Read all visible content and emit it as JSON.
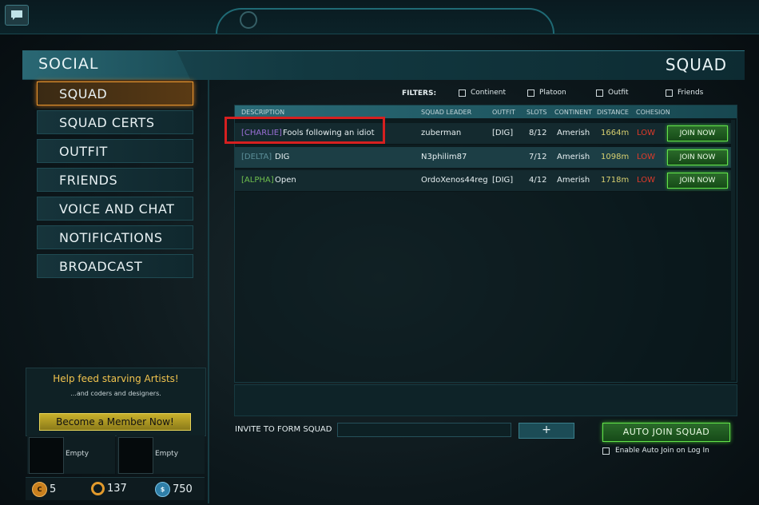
{
  "header": {
    "left_title": "SOCIAL",
    "right_title": "SQUAD"
  },
  "sidebar": {
    "items": [
      {
        "label": "SQUAD",
        "active": true
      },
      {
        "label": "SQUAD CERTS"
      },
      {
        "label": "OUTFIT"
      },
      {
        "label": "FRIENDS"
      },
      {
        "label": "VOICE AND CHAT"
      },
      {
        "label": "NOTIFICATIONS"
      },
      {
        "label": "BROADCAST"
      }
    ]
  },
  "promo": {
    "title": "Help feed starving Artists!",
    "subtitle": "...and coders and designers.",
    "button": "Become a Member Now!"
  },
  "slots": [
    {
      "label": "Empty"
    },
    {
      "label": "Empty"
    }
  ],
  "currency": {
    "certs": "5",
    "coin": "137",
    "cash": "750"
  },
  "filters": {
    "label": "FILTERS:",
    "options": [
      "Continent",
      "Platoon",
      "Outfit",
      "Friends"
    ]
  },
  "table": {
    "columns": [
      "DESCRIPTION",
      "SQUAD LEADER",
      "OUTFIT",
      "SLOTS",
      "CONTINENT",
      "DISTANCE",
      "COHESION"
    ],
    "rows": [
      {
        "tag": "[CHARLIE]",
        "name": "Fools following an idiot",
        "leader": "zuberman",
        "outfit": "[DIG]",
        "slots": "8/12",
        "continent": "Amerish",
        "distance": "1664m",
        "cohesion": "LOW",
        "action": "JOIN NOW"
      },
      {
        "tag": "[DELTA]",
        "name": "DIG",
        "leader": "N3philim87",
        "outfit": "",
        "slots": "7/12",
        "continent": "Amerish",
        "distance": "1098m",
        "cohesion": "LOW",
        "action": "JOIN NOW"
      },
      {
        "tag": "[ALPHA]",
        "name": "Open",
        "leader": "OrdoXenos44reg",
        "outfit": "[DIG]",
        "slots": "4/12",
        "continent": "Amerish",
        "distance": "1718m",
        "cohesion": "LOW",
        "action": "JOIN NOW"
      }
    ]
  },
  "invite": {
    "label": "INVITE TO FORM SQUAD",
    "value": "",
    "plus": "+"
  },
  "auto_join": {
    "button": "AUTO JOIN SQUAD",
    "checkbox_label": "Enable Auto Join on Log In"
  },
  "colors": {
    "accent_orange": "#e8952e",
    "join_green": "#62e34a",
    "low_red": "#e03a2a",
    "highlight_red": "#d62020"
  }
}
